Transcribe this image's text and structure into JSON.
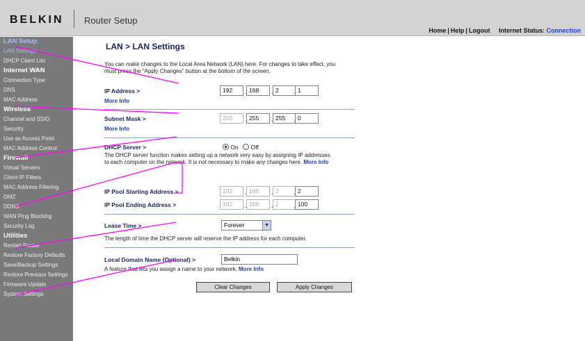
{
  "header": {
    "logo": "BELKIN",
    "title": "Router Setup",
    "nav": {
      "home": "Home",
      "help": "Help",
      "logout": "Logout",
      "sep": "|"
    },
    "status_label": "Internet Status:",
    "status_value": "Connection"
  },
  "sidebar": {
    "groups": [
      {
        "title": "LAN Setup",
        "items": [
          "LAN Settings",
          "DHCP Client List"
        ]
      },
      {
        "title": "Internet WAN",
        "items": [
          "Connection Type",
          "DNS",
          "MAC Address"
        ]
      },
      {
        "title": "Wireless",
        "items": [
          "Channel and SSID",
          "Security",
          "Use as Access Point",
          "MAC Address Control"
        ]
      },
      {
        "title": "Firewall",
        "items": [
          "Virtual Servers",
          "Client IP Filters",
          "MAC Address Filtering",
          "DMZ",
          "DDNS",
          "WAN Ping Blocking",
          "Security Log"
        ]
      },
      {
        "title": "Utilities",
        "items": [
          "Restart Router",
          "Restore Factory Defaults",
          "Save/Backup Settings",
          "Restore Previous Settings",
          "Firmware Update",
          "System Settings"
        ]
      }
    ]
  },
  "main": {
    "title": "LAN > LAN Settings",
    "intro": "You can make changes to the Local Area Network (LAN) here. For changes to take effect, you must press the \"Apply Changes\" button at the bottom of the screen.",
    "ip_address": {
      "label": "IP Address >",
      "more": "More Info",
      "octets": [
        "192",
        "168",
        "2",
        "1"
      ]
    },
    "subnet_mask": {
      "label": "Subnet Mask >",
      "more": "More Info",
      "octets": [
        "255",
        "255",
        "255",
        "0"
      ]
    },
    "dhcp": {
      "label": "DHCP Server >",
      "on_label": "On",
      "off_label": "Off",
      "selected": "On",
      "desc": "The DHCP server function makes setting up a network very easy by assigning IP addresses to each computer on the network. It is not necessary to make any changes here.",
      "more": "More Info"
    },
    "pool_start": {
      "label": "IP Pool Starting Address >",
      "octets": [
        "192",
        "168",
        "2",
        "2"
      ]
    },
    "pool_end": {
      "label": "IP Pool Ending Address >",
      "octets": [
        "192",
        "168",
        "2",
        "100"
      ]
    },
    "lease": {
      "label": "Lease Time >",
      "value": "Forever",
      "desc": "The length of time the DHCP server will reserve the IP address for each computer."
    },
    "domain": {
      "label": "Local Domain Name (Optional) >",
      "value": "Belkin",
      "desc": "A feature that lets you assign a name to your network.",
      "more": "More Info"
    },
    "buttons": {
      "clear": "Clear Changes",
      "apply": "Apply Changes"
    }
  },
  "colors": {
    "sidebar_bg": "#7a7a7a",
    "header_bg": "#d4d4d4",
    "annotation": "#ff00ff",
    "active_category": "#ffff00",
    "label_navy": "#16235c"
  }
}
